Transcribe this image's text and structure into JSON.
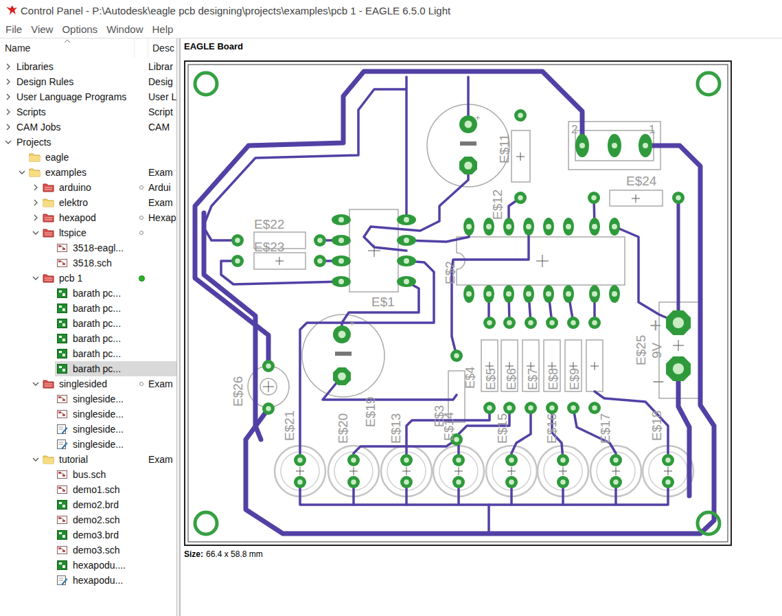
{
  "window": {
    "title": "Control Panel - P:\\Autodesk\\eagle pcb designing\\projects\\examples\\pcb 1 - EAGLE 6.5.0 Light"
  },
  "menu": [
    "File",
    "View",
    "Options",
    "Window",
    "Help"
  ],
  "tree": {
    "columns": [
      "Name",
      "Desc"
    ],
    "items": [
      {
        "label": "Libraries",
        "desc": "Librar",
        "depth": 0,
        "kind": "node",
        "expandable": true,
        "expanded": false,
        "status": "none",
        "selected": false
      },
      {
        "label": "Design Rules",
        "desc": "Desig",
        "depth": 0,
        "kind": "node",
        "expandable": true,
        "expanded": false,
        "status": "none",
        "selected": false
      },
      {
        "label": "User Language Programs",
        "desc": "User L",
        "depth": 0,
        "kind": "node",
        "expandable": true,
        "expanded": false,
        "status": "none",
        "selected": false
      },
      {
        "label": "Scripts",
        "desc": "Script",
        "depth": 0,
        "kind": "node",
        "expandable": true,
        "expanded": false,
        "status": "none",
        "selected": false
      },
      {
        "label": "CAM Jobs",
        "desc": "CAM",
        "depth": 0,
        "kind": "node",
        "expandable": true,
        "expanded": false,
        "status": "none",
        "selected": false
      },
      {
        "label": "Projects",
        "desc": "",
        "depth": 0,
        "kind": "node",
        "expandable": true,
        "expanded": true,
        "status": "none",
        "selected": false
      },
      {
        "label": "eagle",
        "desc": "",
        "depth": 1,
        "kind": "folder",
        "expandable": false,
        "expanded": false,
        "status": "none",
        "selected": false
      },
      {
        "label": "examples",
        "desc": "Exam",
        "depth": 1,
        "kind": "folder",
        "expandable": true,
        "expanded": true,
        "status": "none",
        "selected": false
      },
      {
        "label": "arduino",
        "desc": "Ardui",
        "depth": 2,
        "kind": "project",
        "expandable": true,
        "expanded": false,
        "status": "closed",
        "selected": false
      },
      {
        "label": "elektro",
        "desc": "Exam",
        "depth": 2,
        "kind": "folder",
        "expandable": true,
        "expanded": false,
        "status": "none",
        "selected": false
      },
      {
        "label": "hexapod",
        "desc": "Hexap",
        "depth": 2,
        "kind": "project",
        "expandable": true,
        "expanded": false,
        "status": "closed",
        "selected": false
      },
      {
        "label": "ltspice",
        "desc": "",
        "depth": 2,
        "kind": "project",
        "expandable": true,
        "expanded": true,
        "status": "closed",
        "selected": false
      },
      {
        "label": "3518-eagl...",
        "desc": "",
        "depth": 3,
        "kind": "sch",
        "expandable": false,
        "expanded": false,
        "status": "none",
        "selected": false
      },
      {
        "label": "3518.sch",
        "desc": "",
        "depth": 3,
        "kind": "sch",
        "expandable": false,
        "expanded": false,
        "status": "none",
        "selected": false
      },
      {
        "label": "pcb 1",
        "desc": "",
        "depth": 2,
        "kind": "project",
        "expandable": true,
        "expanded": true,
        "status": "open",
        "selected": false
      },
      {
        "label": "barath pc...",
        "desc": "",
        "depth": 3,
        "kind": "brd",
        "expandable": false,
        "expanded": false,
        "status": "none",
        "selected": false
      },
      {
        "label": "barath pc...",
        "desc": "",
        "depth": 3,
        "kind": "brd",
        "expandable": false,
        "expanded": false,
        "status": "none",
        "selected": false
      },
      {
        "label": "barath pc...",
        "desc": "",
        "depth": 3,
        "kind": "brd",
        "expandable": false,
        "expanded": false,
        "status": "none",
        "selected": false
      },
      {
        "label": "barath pc...",
        "desc": "",
        "depth": 3,
        "kind": "brd",
        "expandable": false,
        "expanded": false,
        "status": "none",
        "selected": false
      },
      {
        "label": "barath pc...",
        "desc": "",
        "depth": 3,
        "kind": "brd",
        "expandable": false,
        "expanded": false,
        "status": "none",
        "selected": false
      },
      {
        "label": "barath pc...",
        "desc": "",
        "depth": 3,
        "kind": "brd",
        "expandable": false,
        "expanded": false,
        "status": "none",
        "selected": true
      },
      {
        "label": "singlesided",
        "desc": "Exam",
        "depth": 2,
        "kind": "project",
        "expandable": true,
        "expanded": true,
        "status": "closed",
        "selected": false
      },
      {
        "label": "singleside...",
        "desc": "",
        "depth": 3,
        "kind": "sch",
        "expandable": false,
        "expanded": false,
        "status": "none",
        "selected": false
      },
      {
        "label": "singleside...",
        "desc": "",
        "depth": 3,
        "kind": "sch",
        "expandable": false,
        "expanded": false,
        "status": "none",
        "selected": false
      },
      {
        "label": "singleside...",
        "desc": "",
        "depth": 3,
        "kind": "scr",
        "expandable": false,
        "expanded": false,
        "status": "none",
        "selected": false
      },
      {
        "label": "singleside...",
        "desc": "",
        "depth": 3,
        "kind": "scr",
        "expandable": false,
        "expanded": false,
        "status": "none",
        "selected": false
      },
      {
        "label": "tutorial",
        "desc": "Exam",
        "depth": 2,
        "kind": "folder",
        "expandable": true,
        "expanded": true,
        "status": "none",
        "selected": false
      },
      {
        "label": "bus.sch",
        "desc": "",
        "depth": 3,
        "kind": "sch",
        "expandable": false,
        "expanded": false,
        "status": "none",
        "selected": false
      },
      {
        "label": "demo1.sch",
        "desc": "",
        "depth": 3,
        "kind": "sch",
        "expandable": false,
        "expanded": false,
        "status": "none",
        "selected": false
      },
      {
        "label": "demo2.brd",
        "desc": "",
        "depth": 3,
        "kind": "brd",
        "expandable": false,
        "expanded": false,
        "status": "none",
        "selected": false
      },
      {
        "label": "demo2.sch",
        "desc": "",
        "depth": 3,
        "kind": "sch",
        "expandable": false,
        "expanded": false,
        "status": "none",
        "selected": false
      },
      {
        "label": "demo3.brd",
        "desc": "",
        "depth": 3,
        "kind": "brd",
        "expandable": false,
        "expanded": false,
        "status": "none",
        "selected": false
      },
      {
        "label": "demo3.sch",
        "desc": "",
        "depth": 3,
        "kind": "sch",
        "expandable": false,
        "expanded": false,
        "status": "none",
        "selected": false
      },
      {
        "label": "hexapodu....",
        "desc": "",
        "depth": 3,
        "kind": "brd",
        "expandable": false,
        "expanded": false,
        "status": "none",
        "selected": false
      },
      {
        "label": "hexapodu...",
        "desc": "",
        "depth": 3,
        "kind": "scr",
        "expandable": false,
        "expanded": false,
        "status": "none",
        "selected": false
      }
    ]
  },
  "board": {
    "title": "EAGLE Board",
    "size_label": "Size:",
    "size_value": "66.4 x 58.8 mm",
    "labels": [
      "E$22",
      "E$23",
      "E$1",
      "E$2",
      "E$12",
      "E$11",
      "E$24",
      "2",
      "1",
      "+",
      "+",
      "E$25",
      "9V",
      "+",
      "−",
      "E$26",
      "E$4",
      "E$5",
      "E$6",
      "E$7",
      "E$8",
      "E$9",
      "E$3",
      "E$14",
      "E$21",
      "E$20",
      "E$19",
      "E$13",
      "E$15",
      "E$16",
      "E$17",
      "E$18"
    ]
  }
}
